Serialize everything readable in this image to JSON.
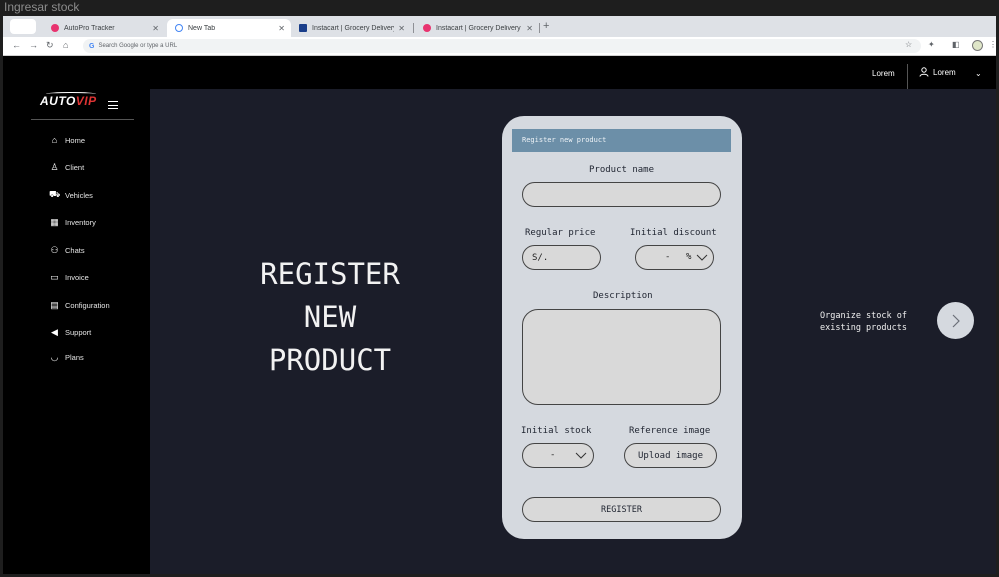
{
  "window": {
    "title": "Ingresar stock"
  },
  "browser": {
    "tabs": [
      {
        "label": "AutoPro Tracker",
        "favicon_color": "#e8336f"
      },
      {
        "label": "New Tab",
        "favicon_color": "#4285f4"
      },
      {
        "label": "Instacart | Grocery Delivery or...",
        "favicon_color": "#1a3e8a"
      },
      {
        "label": "Instacart | Grocery Delivery or...",
        "favicon_color": "#e8336f"
      }
    ],
    "address_placeholder": "Search Google or type a URL"
  },
  "topbar": {
    "link_label": "Lorem",
    "user_label": "Lorem"
  },
  "sidebar": {
    "logo_auto": "AUTO",
    "logo_vip": "VIP",
    "items": [
      {
        "label": "Home",
        "icon": "home-icon"
      },
      {
        "label": "Client",
        "icon": "user-icon"
      },
      {
        "label": "Vehicles",
        "icon": "car-icon"
      },
      {
        "label": "Inventory",
        "icon": "calendar-icon"
      },
      {
        "label": "Chats",
        "icon": "people-icon"
      },
      {
        "label": "Invoice",
        "icon": "folder-icon"
      },
      {
        "label": "Configuration",
        "icon": "document-icon"
      },
      {
        "label": "Support",
        "icon": "megaphone-icon"
      },
      {
        "label": "Plans",
        "icon": "bag-icon"
      }
    ]
  },
  "hero": {
    "line1": "REGISTER",
    "line2": "NEW",
    "line3": "PRODUCT"
  },
  "form": {
    "header": "Register new product",
    "product_name_label": "Product name",
    "regular_price_label": "Regular price",
    "regular_price_value": "S/.",
    "initial_discount_label": "Initial discount",
    "initial_discount_value": "-",
    "initial_discount_unit": "%",
    "description_label": "Description",
    "initial_stock_label": "Initial stock",
    "initial_stock_value": "-",
    "reference_image_label": "Reference image",
    "upload_button": "Upload image",
    "register_button": "REGISTER"
  },
  "side_nav": {
    "line1": "Organize stock of",
    "line2": "existing products"
  },
  "colors": {
    "card_header": "#6c8fa8",
    "main_bg": "#1b1d29",
    "card_bg": "#d5d9df"
  }
}
